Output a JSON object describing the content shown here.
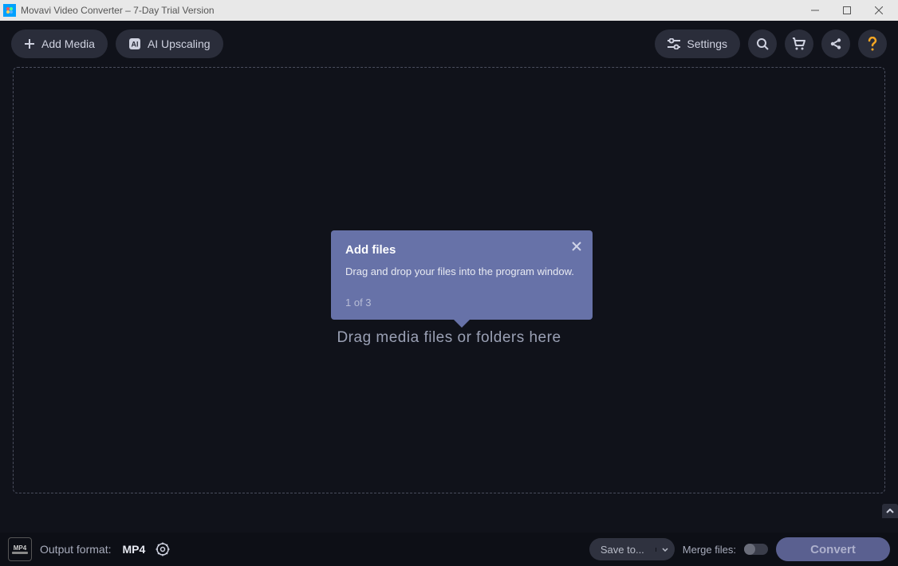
{
  "titlebar": {
    "title": "Movavi Video Converter – 7-Day Trial Version"
  },
  "toolbar": {
    "add_media": "Add Media",
    "ai_upscaling": "AI Upscaling",
    "settings": "Settings"
  },
  "dropzone": {
    "text": "Drag media files or folders here"
  },
  "tooltip": {
    "title": "Add files",
    "body": "Drag and drop your files into the program window.",
    "step": "1 of 3"
  },
  "bottom": {
    "output_label": "Output format:",
    "output_value": "MP4",
    "save_to": "Save to...",
    "merge_label": "Merge files:",
    "convert": "Convert",
    "fmt_badge": "MP4"
  }
}
